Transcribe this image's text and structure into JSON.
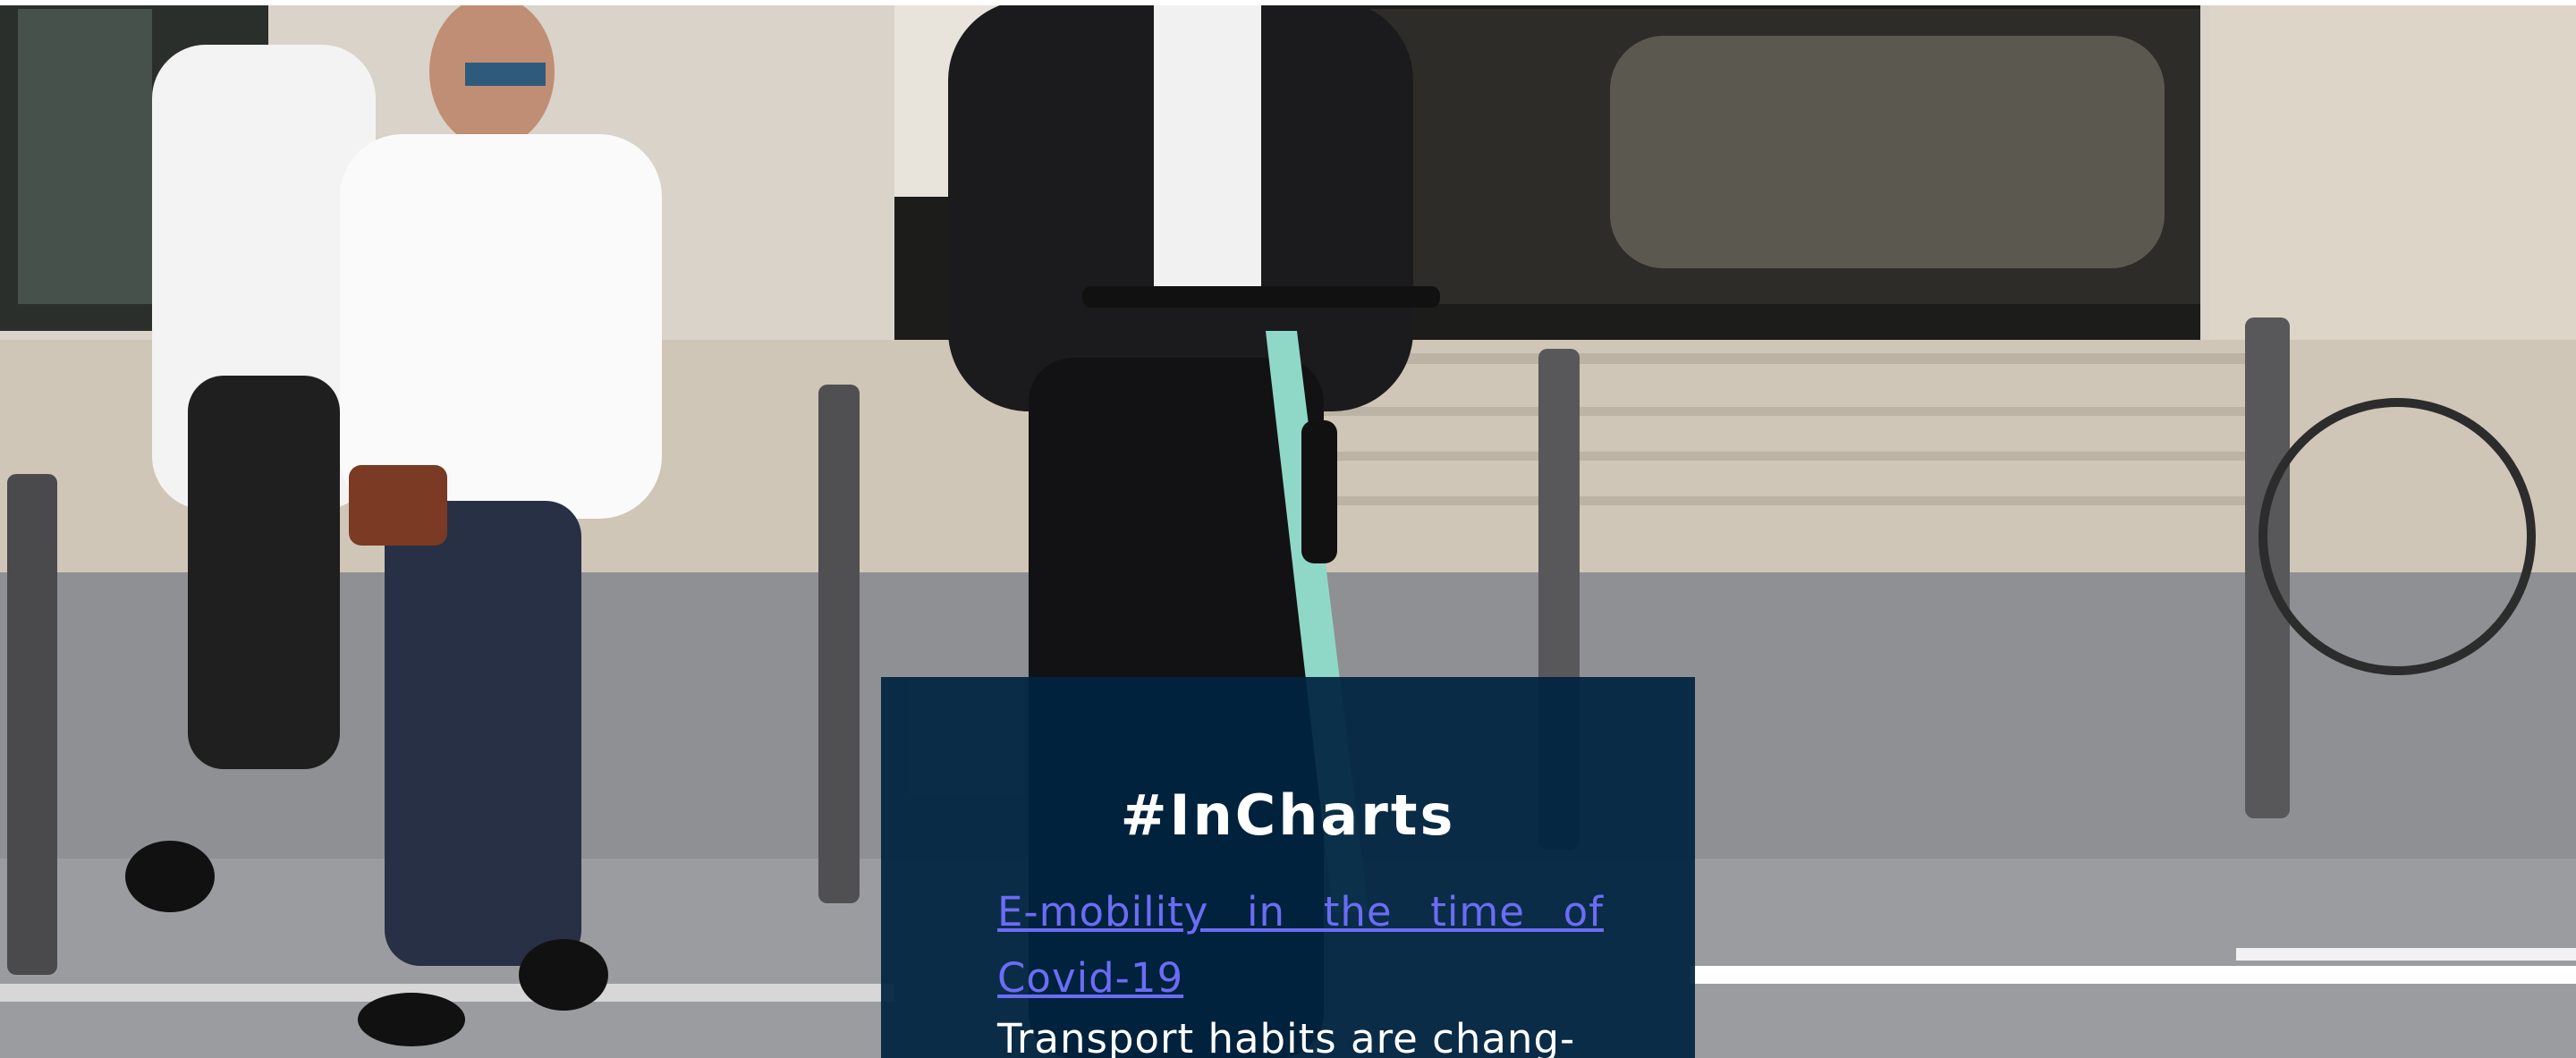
{
  "hero": {
    "image_alt": "Commuters walking and riding an e-scooter on a city street"
  },
  "card": {
    "title": "#InCharts",
    "link_line1": "E-mobility in the time of",
    "link_line2": "Covid-19",
    "text": "Transport habits are chang-"
  },
  "colors": {
    "card_background": "#002440",
    "link": "#6b6cf6",
    "title": "#ffffff"
  }
}
